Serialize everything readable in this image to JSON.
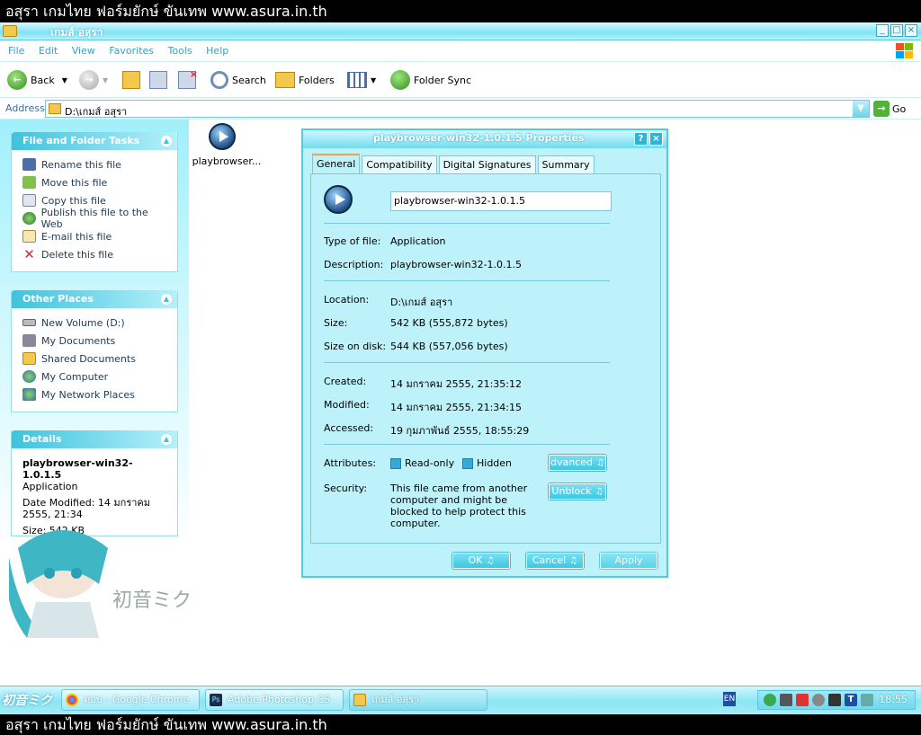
{
  "banner": {
    "text": "อสุรา เกมไทย ฟอร์มยักษ์ ขันเทพ www.asura.in.th"
  },
  "window": {
    "title": "เกมส์ อสุรา"
  },
  "menu": [
    "File",
    "Edit",
    "View",
    "Favorites",
    "Tools",
    "Help"
  ],
  "toolbar": {
    "back": "Back",
    "search": "Search",
    "folders": "Folders",
    "folder_sync": "Folder Sync"
  },
  "address": {
    "label": "Address",
    "path": "D:\\เกมส์ อสุรา",
    "go": "Go"
  },
  "file_tasks": {
    "title": "File and Folder Tasks",
    "items": [
      "Rename this file",
      "Move this file",
      "Copy this file",
      "Publish this file to the Web",
      "E-mail this file",
      "Delete this file"
    ]
  },
  "other_places": {
    "title": "Other Places",
    "items": [
      "New Volume (D:)",
      "My Documents",
      "Shared Documents",
      "My Computer",
      "My Network Places"
    ]
  },
  "details": {
    "title": "Details",
    "name": "playbrowser-win32-1.0.1.5",
    "type": "Application",
    "modified": "Date Modified: 14 มกราคม 2555, 21:34",
    "size": "Size: 542 KB"
  },
  "file": {
    "label": "playbrowser..."
  },
  "dialog": {
    "title": "playbrowser-win32-1.0.1.5 Properties",
    "tabs": [
      "General",
      "Compatibility",
      "Digital Signatures",
      "Summary"
    ],
    "name": "playbrowser-win32-1.0.1.5",
    "type_label": "Type of file:",
    "type": "Application",
    "desc_label": "Description:",
    "desc": "playbrowser-win32-1.0.1.5",
    "loc_label": "Location:",
    "loc": "D:\\เกมส์ อสุรา",
    "size_label": "Size:",
    "size": "542 KB (555,872 bytes)",
    "disk_label": "Size on disk:",
    "disk": "544 KB (557,056 bytes)",
    "created_label": "Created:",
    "created": "14 มกราคม 2555, 21:35:12",
    "modified_label": "Modified:",
    "modified": "14 มกราคม 2555, 21:34:15",
    "accessed_label": "Accessed:",
    "accessed": "19 กุมภาพันธ์ 2555, 18:55:29",
    "attr_label": "Attributes:",
    "readonly": "Read-only",
    "hidden": "Hidden",
    "advanced": "dvanced",
    "sec_label": "Security:",
    "sec_text": "This file came from another computer and might be blocked to help protect this computer.",
    "unblock": "Unblock",
    "ok": "OK",
    "cancel": "Cancel",
    "apply": "Apply"
  },
  "taskbar": {
    "items": [
      "ตอบ - Google Chrome",
      "Adobe Photoshop CS",
      "เกมส์ อสุรา"
    ],
    "lang": "EN",
    "clock": "18:55"
  }
}
